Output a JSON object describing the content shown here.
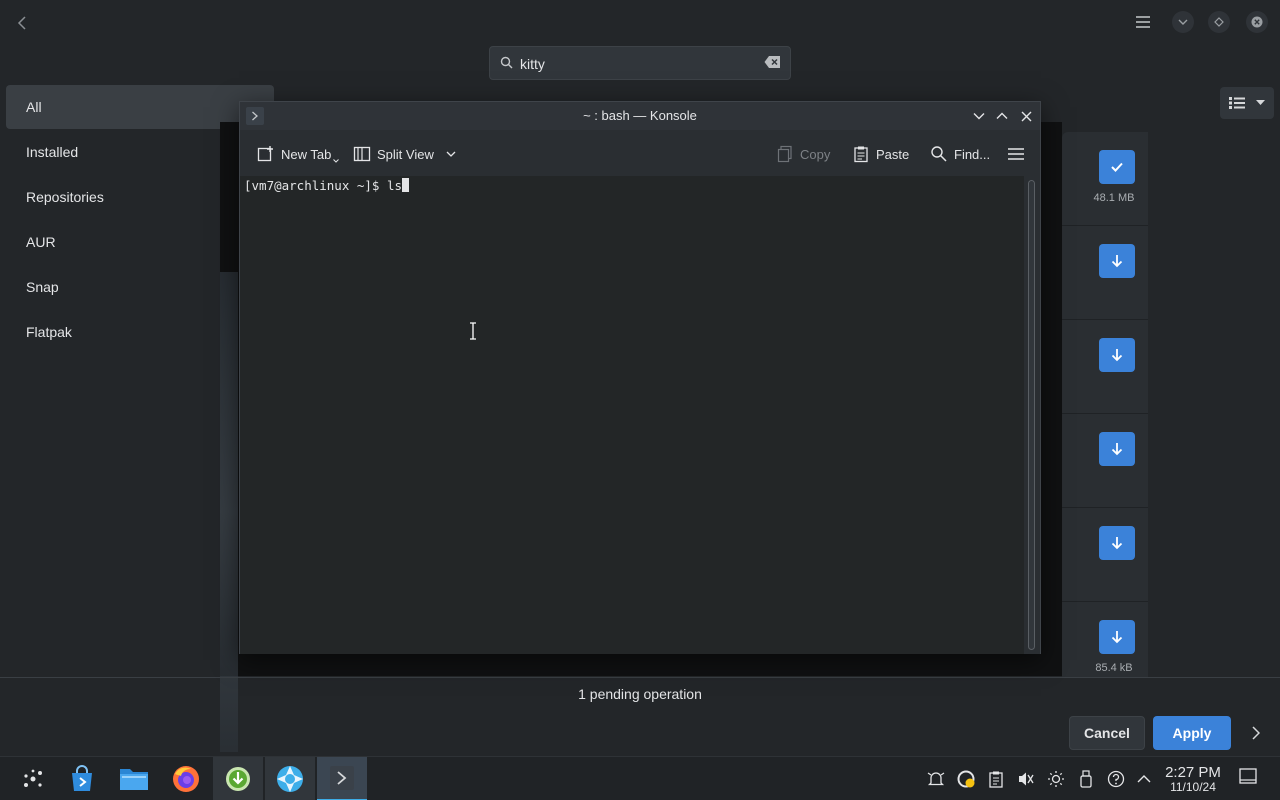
{
  "search": {
    "value": "kitty",
    "placeholder": ""
  },
  "sidebar": {
    "items": [
      {
        "label": "All",
        "active": true
      },
      {
        "label": "Installed"
      },
      {
        "label": "Repositories"
      },
      {
        "label": "AUR"
      },
      {
        "label": "Snap"
      },
      {
        "label": "Flatpak"
      }
    ]
  },
  "app_list": {
    "items": [
      {
        "button": "checkmark-icon",
        "size": "48.1 MB"
      },
      {
        "button": "download-icon",
        "size": ""
      },
      {
        "button": "download-icon",
        "size": ""
      },
      {
        "button": "download-icon",
        "size": ""
      },
      {
        "button": "download-icon",
        "size": ""
      },
      {
        "button": "download-icon",
        "size": "85.4 kB"
      }
    ]
  },
  "footer": {
    "pending": "1 pending operation",
    "cancel_label": "Cancel",
    "apply_label": "Apply"
  },
  "konsole": {
    "title": "~ : bash — Konsole",
    "toolbar": {
      "new_tab": "New Tab",
      "split_view": "Split View",
      "copy": "Copy",
      "paste": "Paste",
      "find": "Find..."
    },
    "prompt": "[vm7@archlinux ~]$ ls"
  },
  "taskbar": {
    "apps": [
      "application-launcher",
      "discover-store",
      "dolphin-files",
      "firefox",
      "package-updater",
      "system-settings",
      "konsole"
    ],
    "time": "2:27 PM",
    "date": "11/10/24"
  },
  "colors": {
    "accent": "#3b82d9",
    "background": "#232629",
    "terminal_bg": "#232627"
  }
}
